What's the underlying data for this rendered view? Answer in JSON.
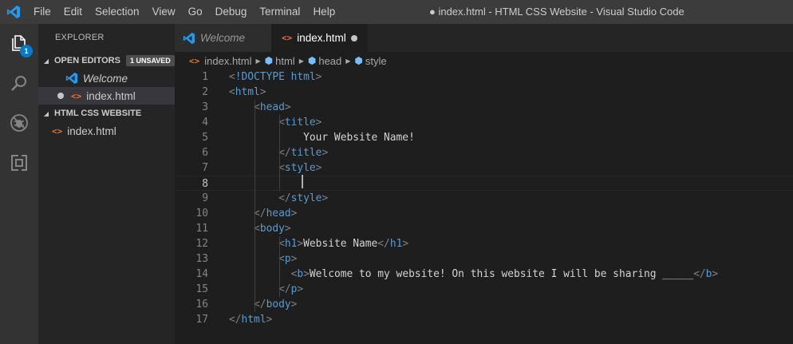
{
  "window_title": "● index.html - HTML CSS Website - Visual Studio Code",
  "menu": [
    "File",
    "Edit",
    "Selection",
    "View",
    "Go",
    "Debug",
    "Terminal",
    "Help"
  ],
  "activity_bar": {
    "items": [
      "explorer-icon",
      "search-icon",
      "debug-icon",
      "extensions-icon"
    ],
    "explorer_badge": "1"
  },
  "sidebar": {
    "title": "EXPLORER",
    "open_editors": {
      "label": "OPEN EDITORS",
      "badge": "1 UNSAVED",
      "items": [
        "Welcome",
        "index.html"
      ]
    },
    "project": {
      "label": "HTML CSS WEBSITE",
      "items": [
        "index.html"
      ]
    }
  },
  "tabs": [
    {
      "label": "Welcome",
      "active": false
    },
    {
      "label": "index.html",
      "active": true,
      "dirty": true
    }
  ],
  "breadcrumb": [
    "index.html",
    "html",
    "head",
    "style"
  ],
  "editor": {
    "current_line": 8,
    "line_numbers": [
      "1",
      "2",
      "3",
      "4",
      "5",
      "6",
      "7",
      "8",
      "9",
      "10",
      "11",
      "12",
      "13",
      "14",
      "15",
      "16",
      "17"
    ],
    "lines": [
      "<!DOCTYPE html>",
      "<html>",
      "    <head>",
      "        <title>",
      "            Your Website Name!",
      "        </title>",
      "        <style>",
      "",
      "        </style>",
      "    </head>",
      "    <body>",
      "        <h1>Website Name</h1>",
      "        <p>",
      "          <b>Welcome to my website! On this website I will be sharing _____</b>",
      "        </p>",
      "    </body>",
      "</html>"
    ]
  },
  "colors": {
    "accent": "#007acc",
    "tag": "#569cd6",
    "punctuation": "#808080",
    "text": "#d4d4d4",
    "html_icon": "#e37933"
  }
}
